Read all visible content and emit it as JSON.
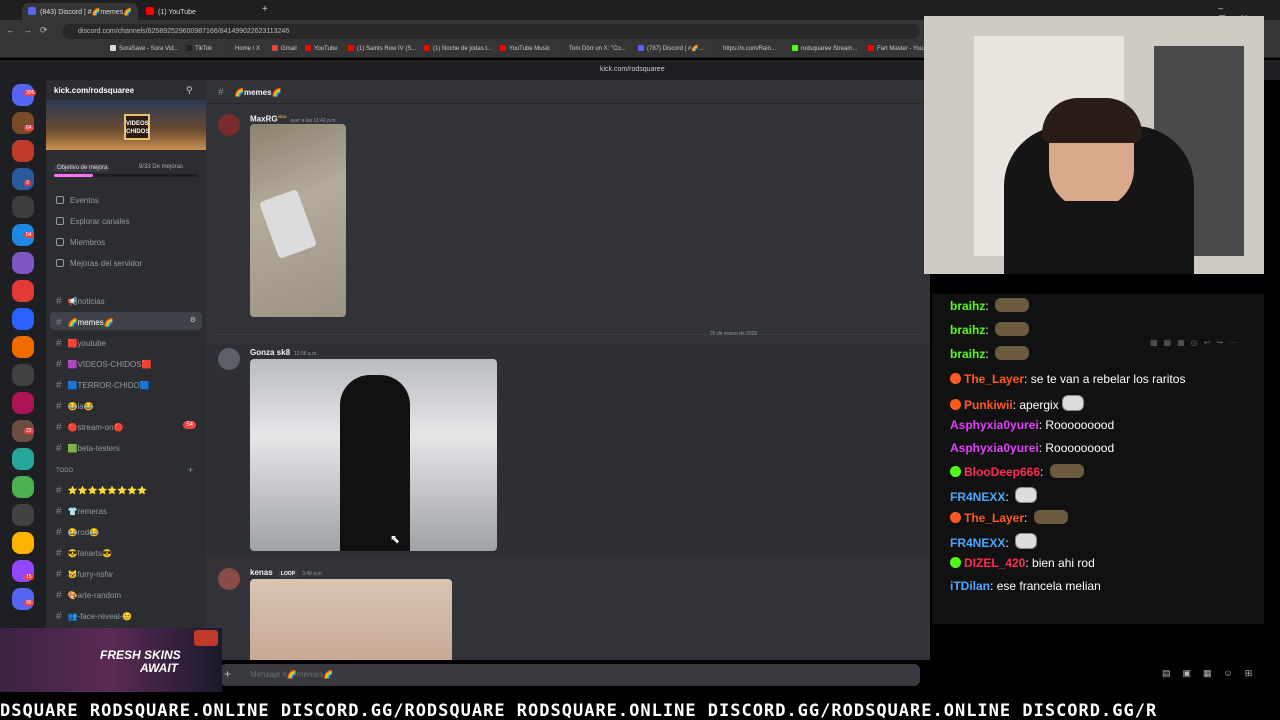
{
  "browser": {
    "tabs": [
      {
        "label": "(843) Discord | #🌈memes🌈",
        "color": "#5865f2"
      },
      {
        "label": "(1) YouTube",
        "color": "#ff0000"
      }
    ],
    "url": "discord.com/channels/825892529600987166/841499022623113246",
    "bookmarks": [
      "SoraSave - Sora Vid...",
      "TikTok",
      "Home / X",
      "Gmail",
      "YouTube",
      "(1) Saints Row IV (S...",
      "(1) Noche de jodas t...",
      "YouTube Music",
      "Tom Dörr on X: \"Co...",
      "(787) Discord | #🌈...",
      "https://x.com/Rain...",
      "rodsquaree Stream...",
      "Fart Master - You..."
    ]
  },
  "overlay_link": "kick.com/rodsquaree",
  "server": {
    "name": "kick.com/rodsquaree",
    "banner_text": "VIDEOS CHIDOS",
    "boost_label": "Objetivo de mejora",
    "boost_progress": "9/33 De mejoras",
    "menu": [
      "Eventos",
      "Explorar canales",
      "Miembros",
      "Mejoras del servidor"
    ],
    "channels": [
      {
        "name": "📢noticias",
        "active": false
      },
      {
        "name": "🌈memes🌈",
        "active": true
      },
      {
        "name": "🟥youtube",
        "active": false
      },
      {
        "name": "🟪VIDEOS-CHIDOS🟥",
        "active": false
      },
      {
        "name": "🟦TERROR-CHIDO🟦",
        "active": false
      },
      {
        "name": "😂la😂",
        "active": false
      },
      {
        "name": "🔴stream-on🔴",
        "active": false,
        "badge": "54"
      },
      {
        "name": "🟩beta-testers",
        "active": false
      }
    ],
    "category": "TODO",
    "channels2": [
      {
        "name": "⭐⭐⭐⭐⭐⭐⭐⭐"
      },
      {
        "name": "👕remeras"
      },
      {
        "name": "😂rod😂"
      },
      {
        "name": "😎fanarts😎"
      },
      {
        "name": "🐱furry-nsfw"
      },
      {
        "name": "🎨arte-random"
      },
      {
        "name": "👥-face-reveal-😊"
      }
    ],
    "rail_badges": [
      "306",
      "64",
      "3",
      "54",
      "22",
      "15",
      "96"
    ]
  },
  "chat": {
    "channel_title": "🌈memes🌈",
    "date_divider": "26 de marzo de 2026",
    "messages": [
      {
        "user": "MaxRG",
        "tag": "2010",
        "time": "ayer a las 11:42 p.m."
      },
      {
        "user": "Gonza sk8",
        "time": "12:08 a.m."
      },
      {
        "user": "kenas",
        "tag": "LOOP",
        "time": "3:49 a.m."
      }
    ],
    "composer_placeholder": "Mensaje #🌈memes🌈"
  },
  "stream_chat": [
    {
      "user": "braihz",
      "color": "#53fc18",
      "text": "",
      "emote": true
    },
    {
      "user": "braihz",
      "color": "#53fc18",
      "text": "",
      "emote": true
    },
    {
      "user": "braihz",
      "color": "#53fc18",
      "text": "",
      "emote": true
    },
    {
      "user": "The_Layer",
      "color": "#ff5a1f",
      "text": "se te van a rebelar los raritos"
    },
    {
      "user": "Punkiwii",
      "color": "#ff5a1f",
      "text": "apergix",
      "emote_w": true
    },
    {
      "user": "Asphyxia0yurei",
      "color": "#e040fb",
      "text": "Rooooooood"
    },
    {
      "user": "Asphyxia0yurei",
      "color": "#e040fb",
      "text": "Rooooooood"
    },
    {
      "user": "BlooDeep666",
      "color": "#ff2d55",
      "text": "",
      "emote": true
    },
    {
      "user": "FR4NEXX",
      "color": "#4aa8ff",
      "text": "",
      "emote_w": true
    },
    {
      "user": "The_Layer",
      "color": "#ff5a1f",
      "text": "",
      "emote": true
    },
    {
      "user": "FR4NEXX",
      "color": "#4aa8ff",
      "text": "",
      "emote_w": true
    },
    {
      "user": "DIZEL_420",
      "color": "#ff2d55",
      "text": "bien ahi rod"
    },
    {
      "user": "iTDilan",
      "color": "#4aa8ff",
      "text": "ese francela melian"
    }
  ],
  "promo": {
    "line1": "FRESH SKINS",
    "line2": "AWAIT"
  },
  "ticker": "DSQUARE RODSQUARE.ONLINE DISCORD.GG/RODSQUARE RODSQUARE.ONLINE DISCORD.GG/RODSQUARE.ONLINE DISCORD.GG/R"
}
